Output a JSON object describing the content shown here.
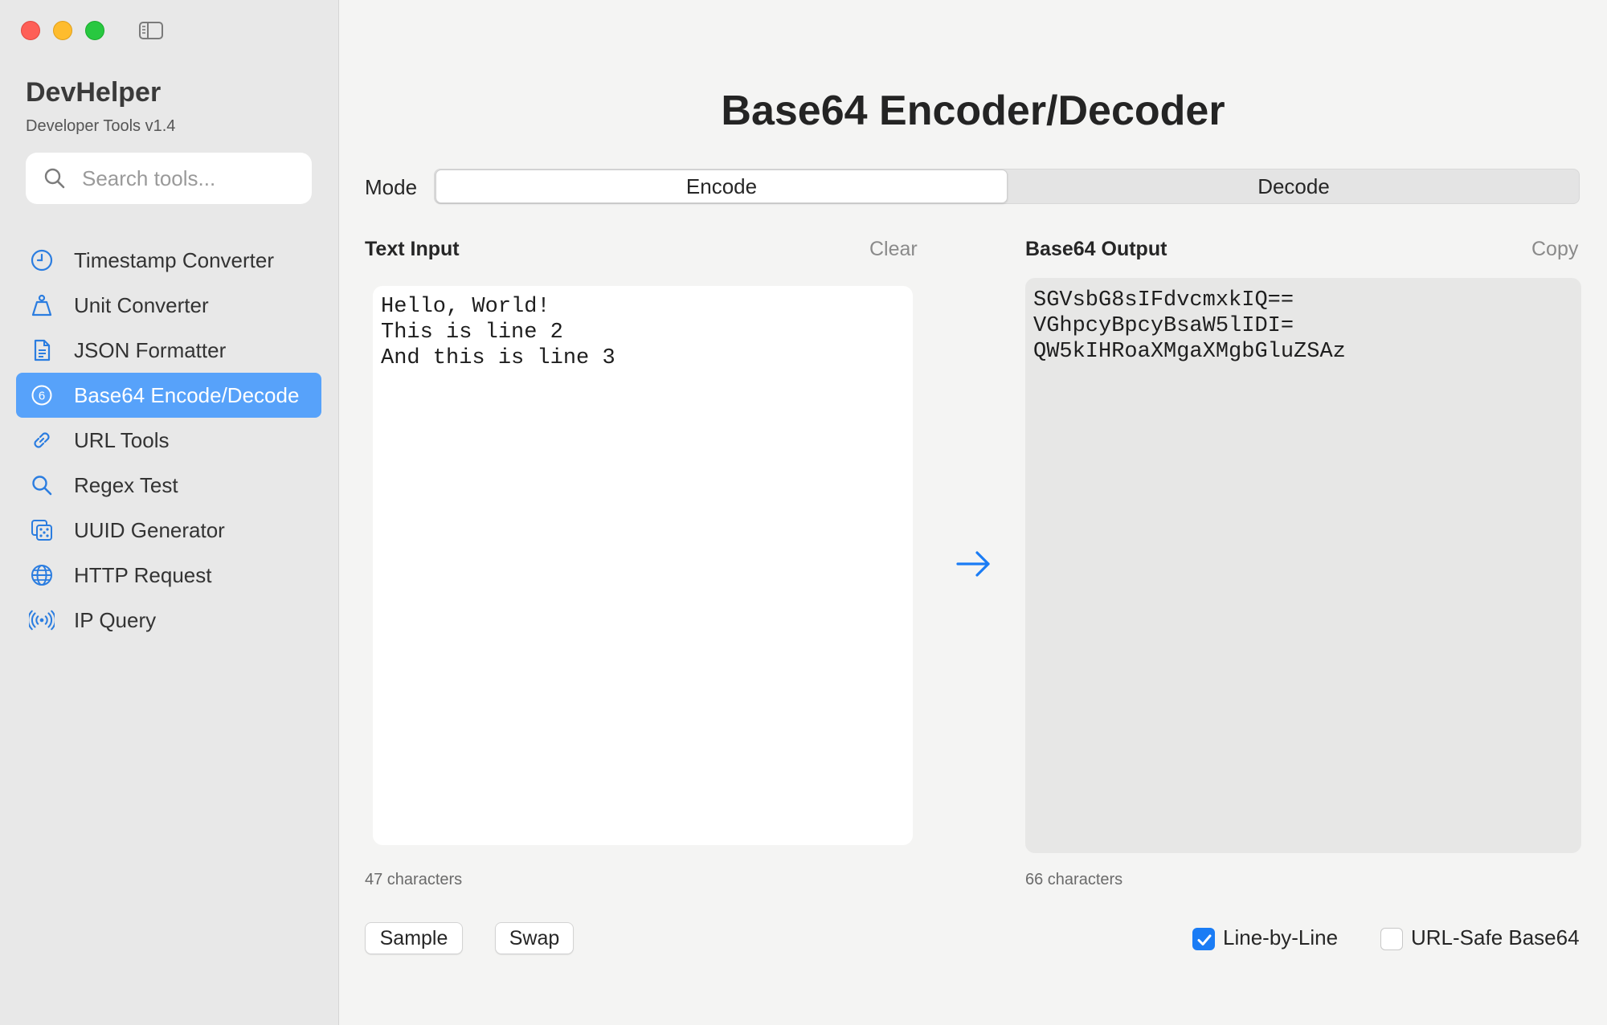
{
  "sidebar": {
    "app_name": "DevHelper",
    "app_subtitle": "Developer Tools v1.4",
    "search_placeholder": "Search tools...",
    "items": [
      {
        "label": "Timestamp Converter",
        "icon": "clock-icon"
      },
      {
        "label": "Unit Converter",
        "icon": "weight-icon"
      },
      {
        "label": "JSON Formatter",
        "icon": "document-icon"
      },
      {
        "label": "Base64 Encode/Decode",
        "icon": "six-circle-icon",
        "active": true
      },
      {
        "label": "URL Tools",
        "icon": "link-icon"
      },
      {
        "label": "Regex Test",
        "icon": "magnifier-icon"
      },
      {
        "label": "UUID Generator",
        "icon": "dice-icon"
      },
      {
        "label": "HTTP Request",
        "icon": "globe-icon"
      },
      {
        "label": "IP Query",
        "icon": "antenna-icon"
      }
    ]
  },
  "main": {
    "title": "Base64 Encoder/Decoder",
    "mode_label": "Mode",
    "modes": [
      "Encode",
      "Decode"
    ],
    "selected_mode": "Encode",
    "input": {
      "title": "Text Input",
      "action": "Clear",
      "text": "Hello, World!\nThis is line 2\nAnd this is line 3",
      "count": "47 characters"
    },
    "output": {
      "title": "Base64 Output",
      "action": "Copy",
      "text": "SGVsbG8sIFdvcmxkIQ==\nVGhpcyBpcyBsaW5lIDI=\nQW5kIHRoaXMgaXMgbGluZSAz",
      "count": "66 characters"
    },
    "buttons": {
      "sample": "Sample",
      "swap": "Swap"
    },
    "options": {
      "line_by_line": {
        "label": "Line-by-Line",
        "checked": true
      },
      "url_safe": {
        "label": "URL-Safe Base64",
        "checked": false
      }
    }
  },
  "colors": {
    "accent": "#1a7cf5",
    "active_item": "#57a2fa",
    "icon_blue": "#2b7de0"
  }
}
